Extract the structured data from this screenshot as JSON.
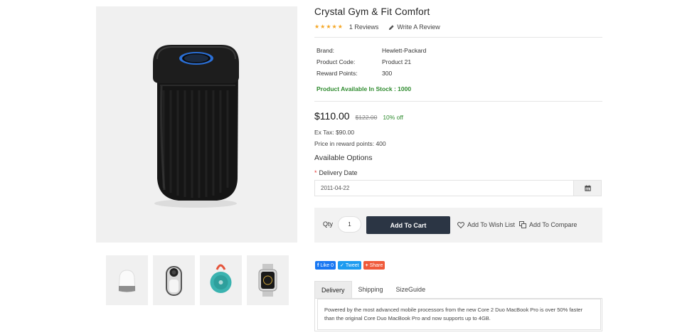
{
  "product": {
    "title": "Crystal Gym & Fit Comfort",
    "rating": 5,
    "reviews_label": "1 Reviews",
    "write_review_label": "Write A Review",
    "specs": [
      {
        "label": "Brand:",
        "value": "Hewlett-Packard"
      },
      {
        "label": "Product Code:",
        "value": "Product 21"
      },
      {
        "label": "Reward Points:",
        "value": "300"
      }
    ],
    "stock_text": "Product Available In Stock : 1000",
    "price_new": "$110.00",
    "price_old": "$122.00",
    "discount": "10% off",
    "ex_tax": "Ex Tax: $90.00",
    "reward_price": "Price in reward points: 400"
  },
  "options": {
    "heading": "Available Options",
    "delivery_label": "Delivery Date",
    "required_mark": "*",
    "delivery_value": "2011-04-22"
  },
  "cart": {
    "qty_label": "Qty",
    "qty_value": "1",
    "add_to_cart_label": "Add To Cart",
    "wish_list_label": "Add To Wish List",
    "compare_label": "Add To Compare"
  },
  "social": {
    "like_label": "Like 0",
    "tweet_label": "Tweet",
    "share_label": "Share"
  },
  "tabs": {
    "items": [
      "Delivery",
      "Shipping",
      "SizeGuide"
    ],
    "active": "Delivery",
    "content": "Powered by the most advanced mobile processors from the new Core 2 Duo MacBook Pro is over 50% faster than the original Core Duo MacBook Pro and now supports up to 4GB."
  },
  "thumbnails": [
    {
      "icon": "smart-speaker-home-icon"
    },
    {
      "icon": "camera-speaker-icon"
    },
    {
      "icon": "portable-speaker-icon"
    },
    {
      "icon": "smartwatch-icon"
    }
  ],
  "colors": {
    "accent_dark": "#2b3544",
    "stock_green": "#2e8b2e",
    "star": "#f5a623",
    "facebook": "#1877f2",
    "twitter": "#1d9bf0",
    "share": "#f05a3a"
  }
}
